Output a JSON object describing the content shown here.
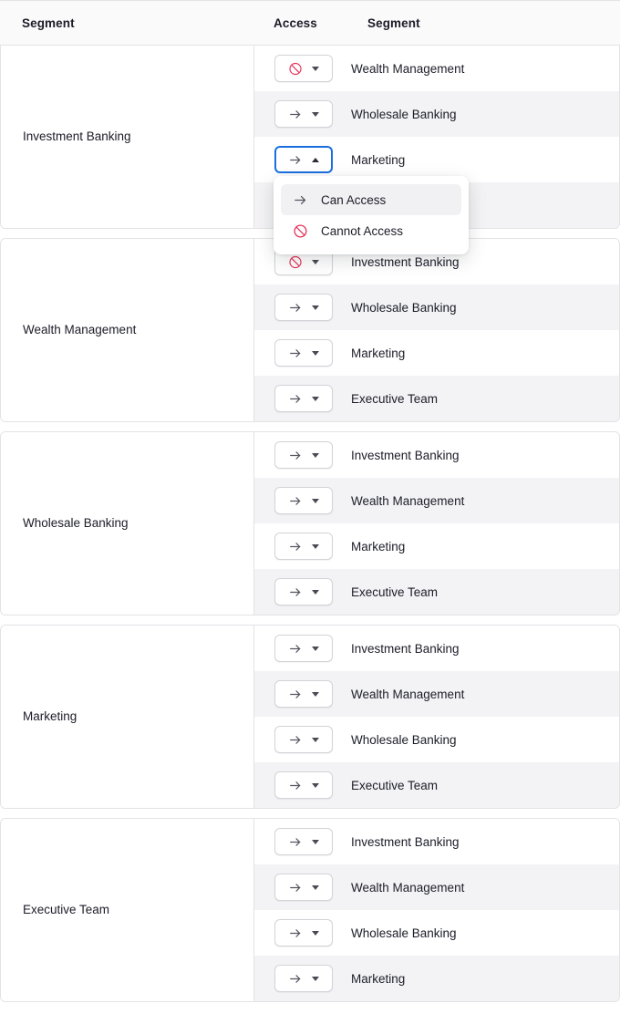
{
  "table": {
    "columns": [
      "Segment",
      "Access",
      "Segment"
    ]
  },
  "colors": {
    "deny": "#e8335a",
    "allow": "#555560",
    "focus_border": "#1a6fe0",
    "stripe": "#f3f3f5",
    "header_bg": "#fafafa",
    "border": "#e3e3e6",
    "text": "#1c1c28"
  },
  "icons": {
    "allow": "arrow-right-icon",
    "deny": "no-entry-icon",
    "caret_down": "chevron-down-icon",
    "caret_up": "chevron-up-icon"
  },
  "dropdown": {
    "open": true,
    "owner_group": 0,
    "owner_row": 2,
    "options": [
      {
        "label": "Can Access",
        "icon": "allow",
        "active": true
      },
      {
        "label": "Cannot Access",
        "icon": "deny",
        "active": false
      }
    ]
  },
  "groups": [
    {
      "label": "Investment Banking",
      "rows": [
        {
          "target": "Wealth Management",
          "access": "deny",
          "striped": false,
          "hidden_by_menu": false
        },
        {
          "target": "Wholesale Banking",
          "access": "allow",
          "striped": true,
          "hidden_by_menu": false
        },
        {
          "target": "Marketing",
          "access": "allow",
          "striped": false,
          "hidden_by_menu": false,
          "open": true
        },
        {
          "target": "",
          "access": "allow",
          "striped": true,
          "hidden_by_menu": true
        }
      ]
    },
    {
      "label": "Wealth Management",
      "rows": [
        {
          "target": "Investment Banking",
          "access": "deny",
          "striped": false
        },
        {
          "target": "Wholesale Banking",
          "access": "allow",
          "striped": true
        },
        {
          "target": "Marketing",
          "access": "allow",
          "striped": false
        },
        {
          "target": "Executive Team",
          "access": "allow",
          "striped": true
        }
      ]
    },
    {
      "label": "Wholesale Banking",
      "rows": [
        {
          "target": "Investment Banking",
          "access": "allow",
          "striped": false
        },
        {
          "target": "Wealth Management",
          "access": "allow",
          "striped": true
        },
        {
          "target": "Marketing",
          "access": "allow",
          "striped": false
        },
        {
          "target": "Executive Team",
          "access": "allow",
          "striped": true
        }
      ]
    },
    {
      "label": "Marketing",
      "rows": [
        {
          "target": "Investment Banking",
          "access": "allow",
          "striped": false
        },
        {
          "target": "Wealth Management",
          "access": "allow",
          "striped": true
        },
        {
          "target": "Wholesale Banking",
          "access": "allow",
          "striped": false
        },
        {
          "target": "Executive Team",
          "access": "allow",
          "striped": true
        }
      ]
    },
    {
      "label": "Executive Team",
      "rows": [
        {
          "target": "Investment Banking",
          "access": "allow",
          "striped": false
        },
        {
          "target": "Wealth Management",
          "access": "allow",
          "striped": true
        },
        {
          "target": "Wholesale Banking",
          "access": "allow",
          "striped": false
        },
        {
          "target": "Marketing",
          "access": "allow",
          "striped": true
        }
      ]
    }
  ]
}
